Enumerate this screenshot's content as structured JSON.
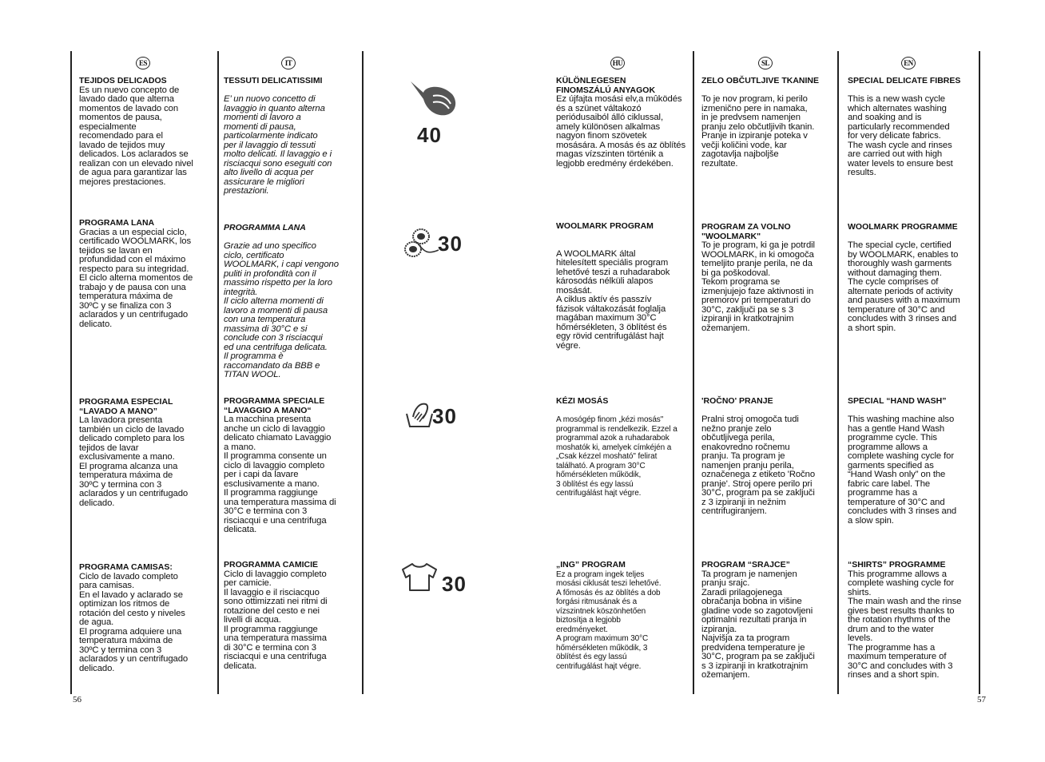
{
  "page_numbers": {
    "left": "56",
    "right": "57"
  },
  "columns": [
    {
      "code": "ES",
      "sections": [
        {
          "title": "TEJIDOS DELICADOS",
          "body": "Es un nuevo concepto de\nlavado dado que alterna\nmomentos de lavado con\nmomentos de pausa,\nespecialmente\nrecomendado para el\nlavado de tejidos muy\ndelicados. Los aclarados se\nrealizan con un elevado nivel\nde agua para garantizar las\nmejores prestaciones."
        },
        {
          "title": "PROGRAMA LANA",
          "body": "Gracias a un especial ciclo,\ncertificado WOOLMARK, los\ntejidos se lavan en\nprofundidad con el máximo\nrespecto para su integridad.\nEl ciclo alterna momentos de\ntrabajo y de pausa con una\ntemperatura máxima de\n30ºC y se finaliza con 3\naclarados y un centrifugado\ndelicato."
        },
        {
          "title": "PROGRAMA ESPECIAL\n“LAVADO A MANO”",
          "body": "La lavadora presenta\ntambién un ciclo de lavado\ndelicado completo para los\ntejidos de lavar\nexclusivamente a mano.\nEl programa alcanza una\ntemperatura máxima de\n30ºC y termina con     3\naclarados y un centrifugado\ndelicado."
        },
        {
          "title": "PROGRAMA CAMISAS:",
          "body": "Ciclo de lavado completo\npara camisas.\nEn el lavado y aclarado se\noptimizan los ritmos de\nrotación del cesto y niveles\nde agua.\nEl programa adquiere una\ntemperatura máxima de\n30ºC y termina con 3\naclarados y un centrifugado\ndelicado."
        }
      ]
    },
    {
      "code": "IT",
      "sections": [
        {
          "title": "TESSUTI DELICATISSIMI",
          "body": "\nE’ un nuovo concetto di\nlavaggio in quanto alterna\nmomenti di lavoro a\nmomenti di pausa,\nparticolarmente indicato\nper il lavaggio di tessuti\nmolto delicati. Il lavaggio e i\nrisciacqui sono eseguiti con\nalto livello di acqua per\nassicurare le migliori\nprestazioni."
        },
        {
          "title": "PROGRAMMA LANA",
          "body": "\nGrazie ad uno specifico\nciclo, certificato\nWOOLMARK, i capi vengono\npuliti in profondità con il\nmassimo rispetto per la loro\nintegrità.\nIl ciclo alterna momenti di\nlavoro a momenti di pausa\ncon una temperatura\nmassima di 30°C e si\nconclude con 3 risciacqui\ned una centrifuga delicata.\nIl programma è\nraccomandato da BBB e\nTITAN WOOL."
        },
        {
          "title": "PROGRAMMA SPECIALE\n“LAVAGGIO A MANO“",
          "body": "La macchina presenta\nanche un ciclo di lavaggio\ndelicato chiamato Lavaggio\na mano.\nIl programma consente un\nciclo di lavaggio completo\nper i capi da lavare\nesclusivamente a mano.\nIl programma raggiunge\nuna temperatura massima di\n30°C e termina con 3\nrisciacqui e una centrifuga\ndelicata."
        },
        {
          "title": "PROGRAMMA CAMICIE",
          "body": "Ciclo di lavaggio completo\nper camicie.\nIl lavaggio e il risciacquo\nsono ottimizzati nei ritmi di\nrotazione del cesto e nei\nlivelli di acqua.\nIl programma raggiunge\nuna temperatura massima\ndi 30°C e termina con 3\nrisciacqui e una centrifuga\ndelicata."
        }
      ]
    },
    {
      "code": "HU",
      "sections": [
        {
          "title": "KÜLÖNLEGESEN\nFINOMSZÁLÚ ANYAGOK",
          "body": "Ez újfajta mosási elv,a mûködés\nés a szünet váltakozó\nperiódusaiból álló ciklussal,\namely különösen alkalmas\nnagyon finom szövetek\nmosására. A mosás és az öblítés\nmagas vízszinten történik a\nlegjobb eredmény érdekében."
        },
        {
          "title": "WOOLMARK PROGRAM",
          "body": "\n\nA WOOLMARK által\nhitelesített speciális program\nlehetővé teszi a ruhadarabok\nkárosodás nélküli alapos\nmosását.\nA ciklus aktív és passzív\nfázisok váltakozását foglalja\nmagában maximum 30°C\nhőmérsékleten, 3 öblítést és\negy rövid centrifugálást hajt\nvégre."
        },
        {
          "title": "KÉZI MOSÁS",
          "body": "\nA mosógép finom „kézi mosás\"\nprogrammal is rendelkezik. Ezzel a\nprogrammal azok a ruhadarabok\nmoshatók ki, amelyek címkéjén a\n„Csak kézzel mosható\" felirat\ntalálható. A program 30°C\nhőmérsékleten működik,\n3 öblítést és egy lassú\ncentrifugálást hajt végre."
        },
        {
          "title": "„ING” PROGRAM",
          "body": "Ez a program ingek teljes\nmosási ciklusát teszi lehetővé.\nA főmosás és az öblítés a dob\nforgási ritmusának és a\nvízszintnek köszönhetően\nbiztosítja a legjobb\neredményeket.\nA program maximum 30°C\nhőmérsékleten működik, 3\nöblítést és egy lassú\ncentrifugálást hajt végre."
        }
      ]
    },
    {
      "code": "SL",
      "sections": [
        {
          "title": "ZELO OBČUTLJIVE TKANINE",
          "body": "\nTo je nov program, ki perilo\nizmenično pere in namaka,\nin je predvsem namenjen\npranju zelo občutljivih tkanin.\nPranje in izpiranje poteka v\nvečji količini vode, kar\nzagotavlja najboljše\nrezultate."
        },
        {
          "title": "PROGRAM ZA VOLNO\n\"WOOLMARK\"",
          "body": "To je program, ki ga je potrdil\nWOOLMARK, in ki omogoča\ntemeljito pranje perila, ne da\nbi ga poškodoval.\nTekom programa se\nizmenjujejo faze aktivnosti in\npremorov pri temperaturi do\n30°C, zaključi pa se s 3\nizpiranji in kratkotrajnim\nožemanjem."
        },
        {
          "title": "'ROČNO' PRANJE",
          "body": "\nPralni stroj omogoča tudi\nnežno pranje zelo\nobčutljivega perila,\nenakovredno ročnemu\npranju. Ta program je\nnamenjen pranju perila,\noznačenega z etiketo 'Ročno\npranje'. Stroj opere perilo pri\n30°C, program pa se zaključi\nz 3 izpiranji in nežnim\ncentrifugiranjem."
        },
        {
          "title": "PROGRAM “SRAJCE”",
          "body": "Ta program je namenjen\npranju srajc.\nZaradi prilagojenega\nobračanja bobna in višine\ngladine vode so zagotovljeni\noptimalni rezultati pranja in\nizpiranja.\nNajvišja za ta program\npredvidena temperature je\n30°C, program pa se zaključi\ns 3 izpiranji in kratkotrajnim\nožemanjem."
        }
      ]
    },
    {
      "code": "EN",
      "sections": [
        {
          "title": "SPECIAL DELICATE FIBRES",
          "body": "\nThis is a new wash cycle\nwhich alternates washing\nand soaking and is\nparticularly recommended\nfor very delicate fabrics.\nThe wash cycle and rinses\nare carried out with high\nwater levels to ensure best\nresults."
        },
        {
          "title": "WOOLMARK PROGRAMME",
          "body": "\nThe special cycle, certified\nby WOOLMARK, enables to\nthoroughly wash garments\nwithout damaging them.\nThe cycle comprises of\nalternate periods of activity\nand pauses with a maximum\ntemperature of 30°C and\nconcludes with 3 rinses and\na short spin."
        },
        {
          "title": "SPECIAL “HAND WASH”",
          "body": "\nThis washing machine also\nhas a gentle Hand Wash\nprogramme cycle. This\nprogramme allows a\ncomplete washing cycle for\ngarments specified as\n“Hand Wash only” on the\nfabric care label. The\nprogramme has a\ntemperature of 30°C and\nconcludes with 3 rinses and\na slow spin."
        },
        {
          "title": "“SHIRTS” PROGRAMME",
          "body": "This programme allows a\ncomplete washing cycle for\nshirts.\nThe main wash and the rinse\ngives best results thanks to\nthe rotation rhythms of the\ndrum and to the water\nlevels.\nThe programme has a\nmaximum temperature of\n30°C and concludes with 3\nrinses and a short spin."
        }
      ]
    }
  ],
  "programme_icons": [
    {
      "icon": "feather-icon",
      "temperature": "40"
    },
    {
      "icon": "wool-skein-icon",
      "temperature": "30"
    },
    {
      "icon": "hand-wash-icon",
      "temperature": "30"
    },
    {
      "icon": "shirt-icon",
      "temperature": "30"
    }
  ]
}
